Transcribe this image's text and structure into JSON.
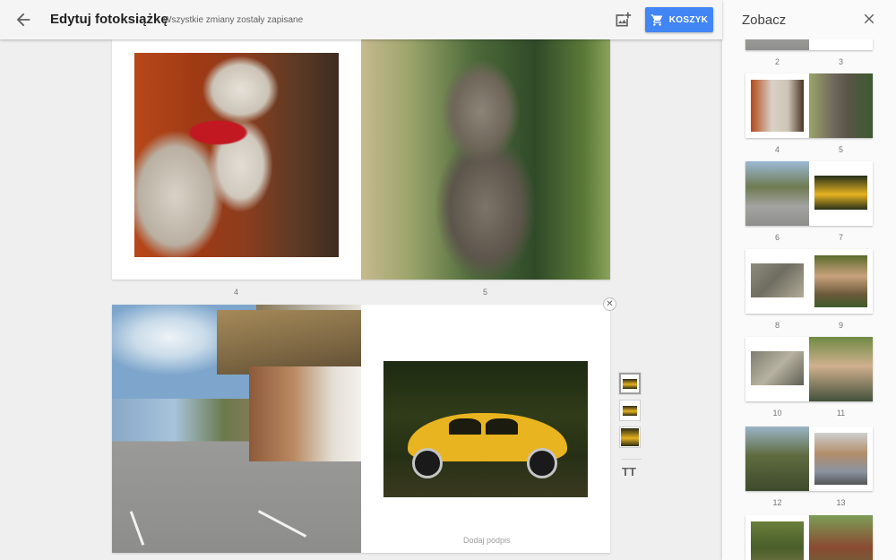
{
  "header": {
    "title": "Edytuj fotoksiążkę",
    "status": "Wszystkie zmiany zostały zapisane",
    "cart_label": "KOSZYK",
    "accent_color": "#4285f4"
  },
  "icons": {
    "back": "arrow-back-icon",
    "add_photo": "add-photo-icon",
    "cart": "shopping-cart-icon",
    "close": "close-icon",
    "text": "text-format-icon"
  },
  "canvas": {
    "spread1_pages": [
      "4",
      "5"
    ],
    "spread2_caption": "Dodaj podpis",
    "text_tool_label": "TT"
  },
  "panel": {
    "title": "Zobacz",
    "top_pages": [
      "2",
      "3"
    ],
    "spreads": [
      {
        "left": "4",
        "right": "5"
      },
      {
        "left": "6",
        "right": "7"
      },
      {
        "left": "8",
        "right": "9"
      },
      {
        "left": "10",
        "right": "11"
      },
      {
        "left": "12",
        "right": "13"
      }
    ]
  }
}
